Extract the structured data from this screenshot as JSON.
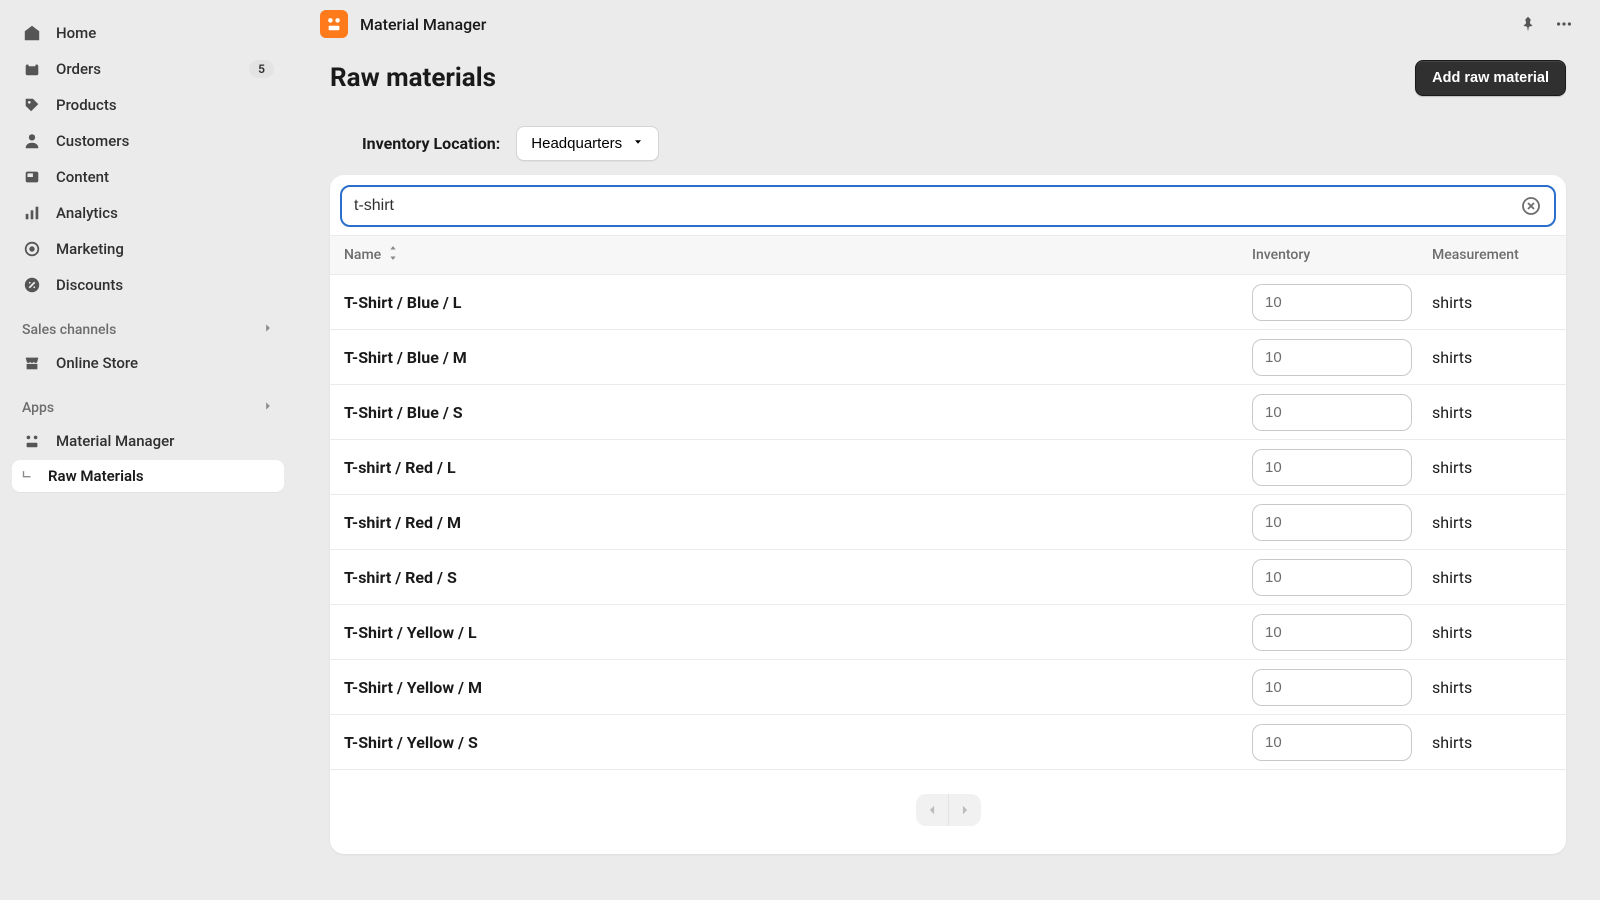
{
  "app": {
    "title": "Material Manager"
  },
  "page": {
    "title": "Raw materials",
    "primaryAction": "Add raw material"
  },
  "sidebar": {
    "nav": [
      {
        "label": "Home",
        "badge": null
      },
      {
        "label": "Orders",
        "badge": "5"
      },
      {
        "label": "Products",
        "badge": null
      },
      {
        "label": "Customers",
        "badge": null
      },
      {
        "label": "Content",
        "badge": null
      },
      {
        "label": "Analytics",
        "badge": null
      },
      {
        "label": "Marketing",
        "badge": null
      },
      {
        "label": "Discounts",
        "badge": null
      }
    ],
    "salesChannelsHeader": "Sales channels",
    "salesChannels": [
      {
        "label": "Online Store"
      }
    ],
    "appsHeader": "Apps",
    "apps": [
      {
        "label": "Material Manager"
      }
    ],
    "appSubnav": {
      "label": "Raw Materials"
    }
  },
  "filter": {
    "label": "Inventory Location:",
    "value": "Headquarters"
  },
  "search": {
    "value": "t-shirt"
  },
  "table": {
    "headers": {
      "name": "Name",
      "inventory": "Inventory",
      "measurement": "Measurement"
    },
    "rows": [
      {
        "name": "T-Shirt / Blue / L",
        "inventory": "10",
        "measurement": "shirts"
      },
      {
        "name": "T-Shirt / Blue / M",
        "inventory": "10",
        "measurement": "shirts"
      },
      {
        "name": "T-Shirt / Blue / S",
        "inventory": "10",
        "measurement": "shirts"
      },
      {
        "name": "T-shirt / Red / L",
        "inventory": "10",
        "measurement": "shirts"
      },
      {
        "name": "T-shirt / Red / M",
        "inventory": "10",
        "measurement": "shirts"
      },
      {
        "name": "T-shirt / Red / S",
        "inventory": "10",
        "measurement": "shirts"
      },
      {
        "name": "T-Shirt / Yellow / L",
        "inventory": "10",
        "measurement": "shirts"
      },
      {
        "name": "T-Shirt / Yellow / M",
        "inventory": "10",
        "measurement": "shirts"
      },
      {
        "name": "T-Shirt / Yellow / S",
        "inventory": "10",
        "measurement": "shirts"
      }
    ]
  }
}
